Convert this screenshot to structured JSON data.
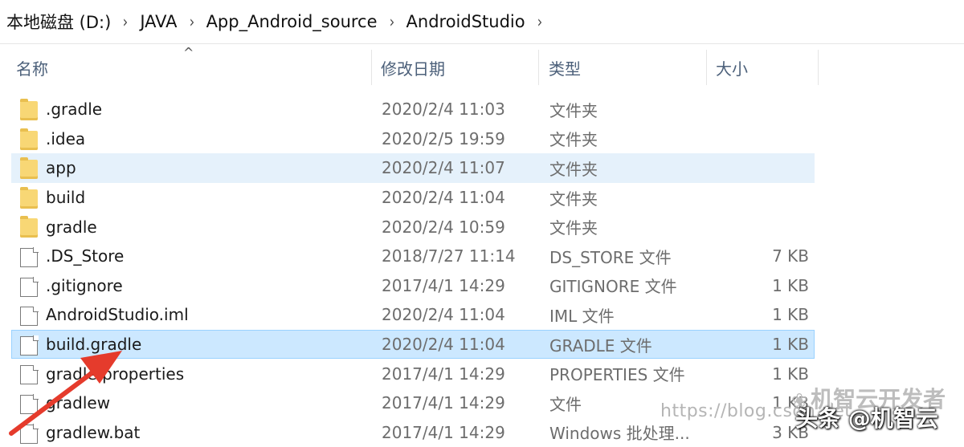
{
  "breadcrumb": {
    "items": [
      "本地磁盘 (D:)",
      "JAVA",
      "App_Android_source",
      "AndroidStudio"
    ],
    "separator": "›"
  },
  "columns": {
    "name": "名称",
    "date": "修改日期",
    "type": "类型",
    "size": "大小",
    "sort_indicator": "^"
  },
  "files": [
    {
      "icon": "folder-icon",
      "name": ".gradle",
      "date": "2020/2/4 11:03",
      "type": "文件夹",
      "size": ""
    },
    {
      "icon": "folder-icon",
      "name": ".idea",
      "date": "2020/2/5 19:59",
      "type": "文件夹",
      "size": ""
    },
    {
      "icon": "folder-icon",
      "name": "app",
      "date": "2020/2/4 11:07",
      "type": "文件夹",
      "size": ""
    },
    {
      "icon": "folder-icon",
      "name": "build",
      "date": "2020/2/4 11:04",
      "type": "文件夹",
      "size": ""
    },
    {
      "icon": "folder-icon",
      "name": "gradle",
      "date": "2020/2/4 10:59",
      "type": "文件夹",
      "size": ""
    },
    {
      "icon": "file-icon",
      "name": ".DS_Store",
      "date": "2018/7/27 11:14",
      "type": "DS_STORE 文件",
      "size": "7 KB"
    },
    {
      "icon": "file-icon",
      "name": ".gitignore",
      "date": "2017/4/1 14:29",
      "type": "GITIGNORE 文件",
      "size": "1 KB"
    },
    {
      "icon": "file-icon",
      "name": "AndroidStudio.iml",
      "date": "2020/2/4 11:04",
      "type": "IML 文件",
      "size": "1 KB"
    },
    {
      "icon": "file-icon",
      "name": "build.gradle",
      "date": "2020/2/4 11:04",
      "type": "GRADLE 文件",
      "size": "1 KB"
    },
    {
      "icon": "file-icon",
      "name": "gradle.properties",
      "date": "2017/4/1 14:29",
      "type": "PROPERTIES 文件",
      "size": "1 KB"
    },
    {
      "icon": "file-icon",
      "name": "gradlew",
      "date": "2017/4/1 14:29",
      "type": "文件",
      "size": "1 KB"
    },
    {
      "icon": "file-icon",
      "name": "gradlew.bat",
      "date": "2017/4/1 14:29",
      "type": "Windows 批处理...",
      "size": "3 KB"
    }
  ],
  "selection": {
    "hovered_row": "app",
    "selected_row": "build.gradle"
  },
  "colors": {
    "selected_bg": "#cce8ff",
    "hover_bg": "#e5f1fb",
    "folder": "#f8d775",
    "annotation_arrow": "#e53b2c"
  },
  "watermark": {
    "url": "https://blog.csdn.net",
    "brand": "机智云开发者",
    "brand_icon": "wechat-icon",
    "main": "头条 @机智云"
  }
}
